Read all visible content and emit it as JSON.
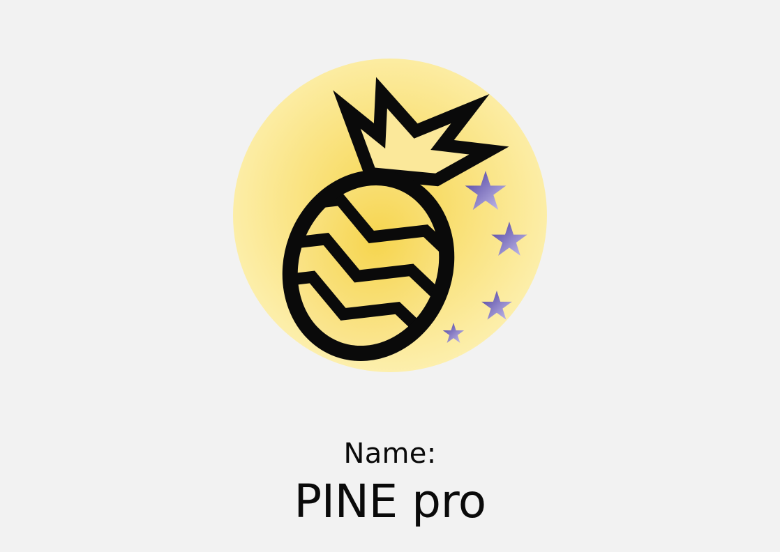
{
  "logo": {
    "icon": "pineapple-icon",
    "stars_icon": "stars-icon",
    "colors": {
      "circle_inner": "#f6d54e",
      "circle_outer": "#fdf0b0",
      "outline": "#0a0a0a",
      "star_dark": "#4a3c9c",
      "star_light": "#c9c2ee",
      "background": "#f2f2f2"
    }
  },
  "name": {
    "label": "Name:",
    "value": "PINE pro"
  }
}
